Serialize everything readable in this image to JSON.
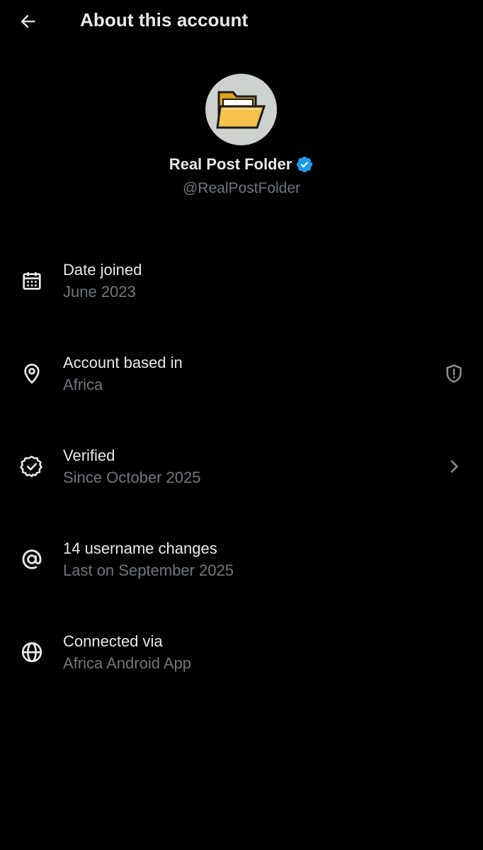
{
  "header": {
    "title": "About this account",
    "back_icon": "arrow-left-icon"
  },
  "profile": {
    "display_name": "Real Post Folder",
    "handle": "@RealPostFolder",
    "verified": true,
    "avatar_icon": "open-folder-icon",
    "verified_color": "#1d9bf0"
  },
  "rows": [
    {
      "icon": "calendar-icon",
      "label": "Date joined",
      "value": "June 2023"
    },
    {
      "icon": "location-pin-icon",
      "label": "Account based in",
      "value": "Africa",
      "trailing_icon": "shield-icon"
    },
    {
      "icon": "verified-badge-icon",
      "label": "Verified",
      "value": "Since October 2025",
      "trailing_icon": "chevron-right-icon"
    },
    {
      "icon": "at-sign-icon",
      "label": "14 username changes",
      "value": "Last on September 2025"
    },
    {
      "icon": "globe-icon",
      "label": "Connected via",
      "value": "Africa Android App"
    }
  ],
  "colors": {
    "background": "#000000",
    "primary_text": "#e7e9ea",
    "secondary_text": "#71767b",
    "accent": "#1d9bf0"
  }
}
